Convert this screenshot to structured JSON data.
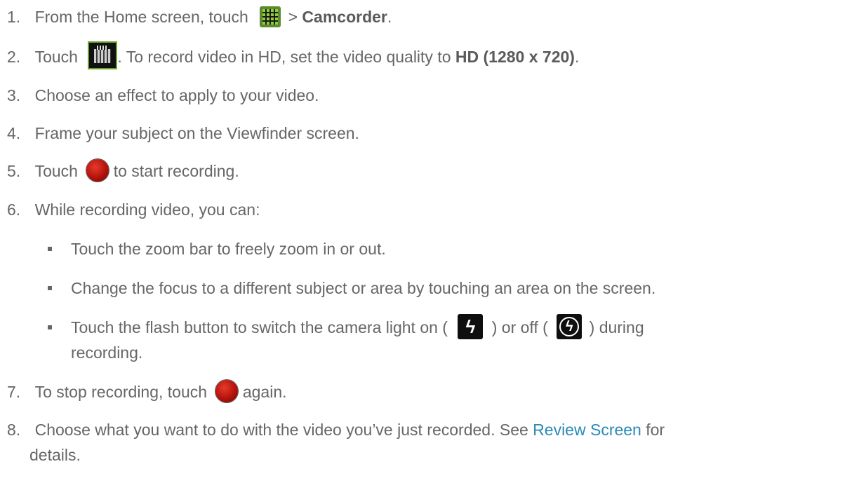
{
  "steps": [
    {
      "num": "1.",
      "pre": "From the Home screen, touch",
      "mid": ">",
      "bold": "Camcorder",
      "post": "."
    },
    {
      "num": "2.",
      "pre": "Touch",
      "mid": ". To record video in HD, set the video quality to",
      "bold": "HD (1280 x 720)",
      "post": "."
    },
    {
      "num": "3.",
      "text": "Choose an effect to apply to your video."
    },
    {
      "num": "4.",
      "text": "Frame your subject on the Viewfinder screen."
    },
    {
      "num": "5.",
      "pre": "Touch",
      "post": "to start recording."
    },
    {
      "num": "6.",
      "text": "While recording video, you can:"
    },
    {
      "num": "7.",
      "pre": "To stop recording, touch",
      "post": "again."
    },
    {
      "num": "8.",
      "text": "Choose what you want to do with the video you’ve just recorded. See",
      "link": "Review Screen",
      "post": "for",
      "line2": "details."
    }
  ],
  "bullets": [
    {
      "text": "Touch the zoom bar to freely zoom in or out."
    },
    {
      "text": "Change the focus to a different subject or area by touching an area on the screen."
    },
    {
      "pre": "Touch the flash button to switch the camera light on (",
      "mid": ") or off (",
      "post": ") during",
      "line2": "recording."
    }
  ],
  "icons": {
    "apps": "apps-grid-icon",
    "quality": "video-quality-icon",
    "record": "record-button-icon",
    "flash_on": "flash-on-icon",
    "flash_off": "flash-off-icon"
  },
  "colors": {
    "text": "#666666",
    "link": "#2a8ab8"
  }
}
